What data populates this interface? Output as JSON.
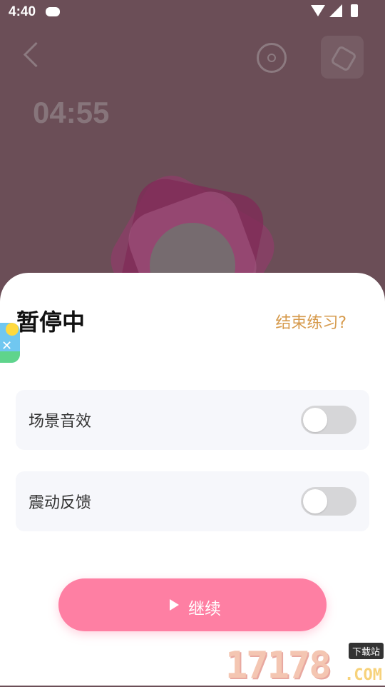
{
  "status_bar": {
    "time": "4:40"
  },
  "background": {
    "timer": "04:55"
  },
  "sheet": {
    "title": "暂停中",
    "end_link": "结束练习?",
    "settings": [
      {
        "label": "场景音效",
        "enabled": false
      },
      {
        "label": "震动反馈",
        "enabled": false
      }
    ],
    "continue_label": "继续"
  },
  "watermark": {
    "digits": "17178",
    "badge": "下载站",
    "suffix": ".COM"
  },
  "colors": {
    "accent": "#fe7fa3",
    "link": "#d69a4c",
    "toggle_off": "#d6d6d8"
  }
}
